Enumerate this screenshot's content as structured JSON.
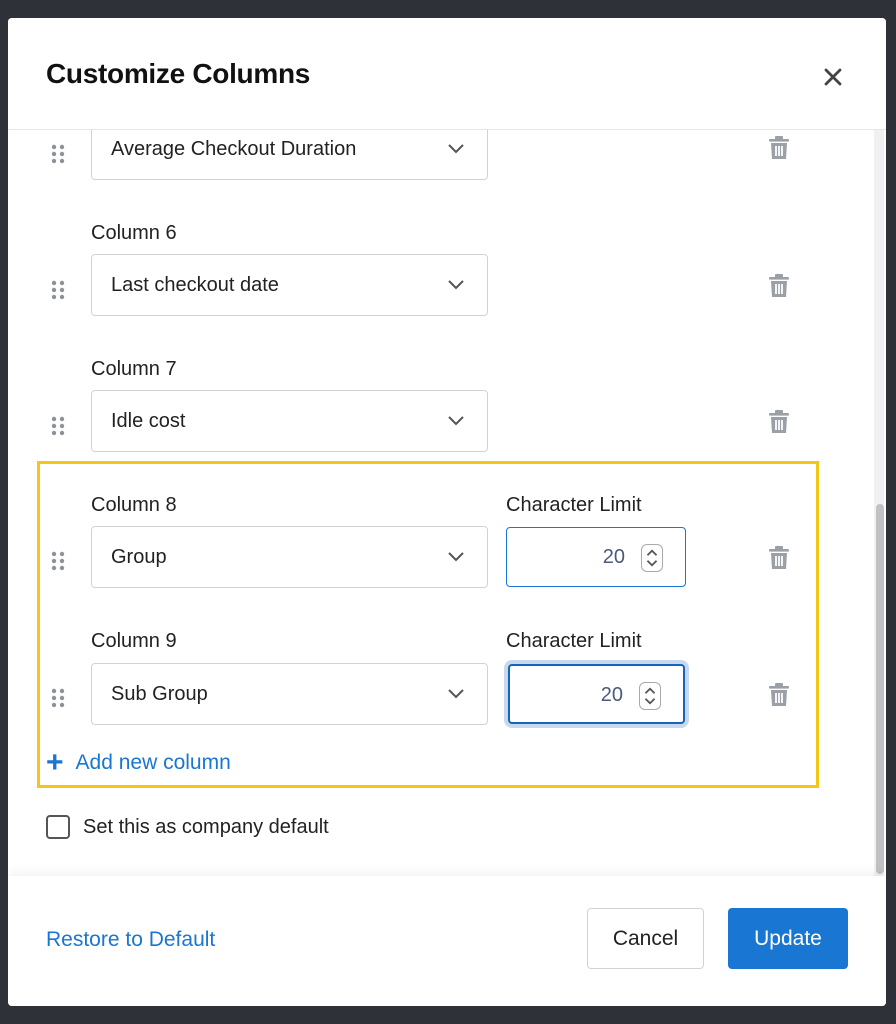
{
  "dialog": {
    "title": "Customize Columns"
  },
  "columns": [
    {
      "label": "",
      "value": "Average Checkout Duration",
      "has_char_limit": false
    },
    {
      "label": "Column 6",
      "value": "Last checkout date",
      "has_char_limit": false
    },
    {
      "label": "Column 7",
      "value": "Idle cost",
      "has_char_limit": false
    },
    {
      "label": "Column 8",
      "value": "Group",
      "has_char_limit": true,
      "char_limit_label": "Character Limit",
      "char_limit": "20"
    },
    {
      "label": "Column 9",
      "value": "Sub Group",
      "has_char_limit": true,
      "char_limit_label": "Character Limit",
      "char_limit": "20"
    }
  ],
  "add_column_label": "Add new column",
  "company_default": {
    "label": "Set this as company default",
    "checked": false
  },
  "footer": {
    "restore_label": "Restore to Default",
    "cancel_label": "Cancel",
    "update_label": "Update"
  },
  "icons": {
    "close": "close-icon",
    "drag": "drag-handle-icon",
    "delete": "trash-icon",
    "chevron": "chevron-down-icon",
    "add": "plus-icon",
    "stepper": "stepper-icon"
  },
  "colors": {
    "accent": "#1976d2",
    "highlight": "#f2c718",
    "backdrop": "#2e3238"
  }
}
